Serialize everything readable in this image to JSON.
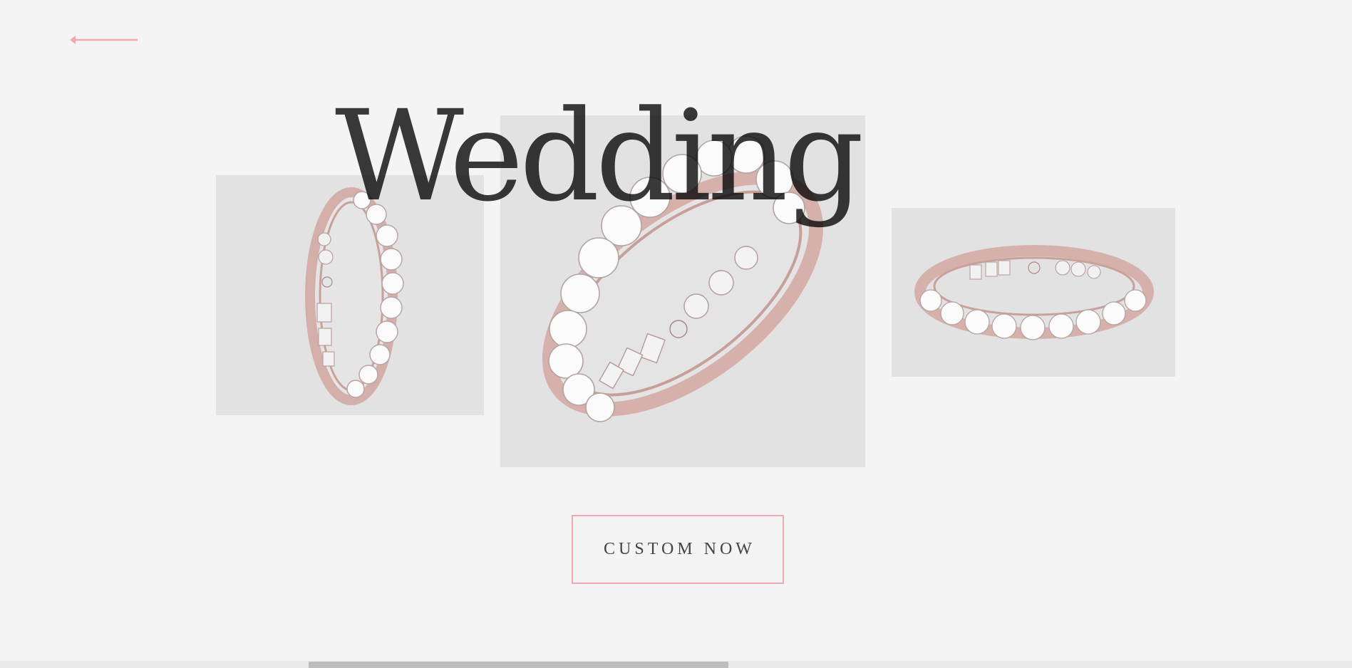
{
  "hero": {
    "title": "Wedding",
    "cta_label": "CUSTOM NOW"
  },
  "navigation": {
    "back_icon": "arrow-left-icon"
  },
  "gallery": {
    "items": [
      {
        "image": "eternity-ring-side-view"
      },
      {
        "image": "eternity-ring-angled-view"
      },
      {
        "image": "eternity-ring-flat-view"
      }
    ]
  },
  "colors": {
    "background": "#f4f4f4",
    "accent": "#f2a7b1",
    "title": "#3a3a3a",
    "photo_bg": "#e2e2e2",
    "ring_metal": "#d9b5b0"
  }
}
